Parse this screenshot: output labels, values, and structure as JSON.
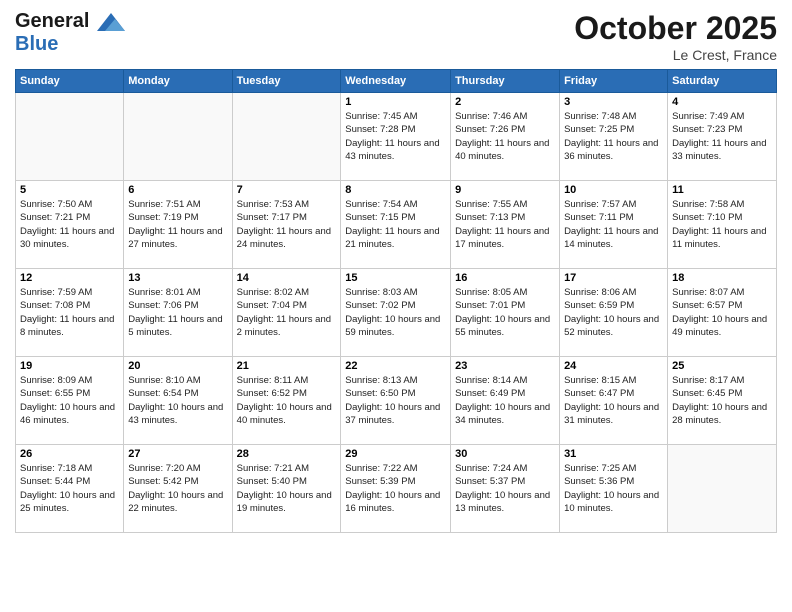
{
  "header": {
    "logo_line1": "General",
    "logo_line2": "Blue",
    "month": "October 2025",
    "location": "Le Crest, France"
  },
  "weekdays": [
    "Sunday",
    "Monday",
    "Tuesday",
    "Wednesday",
    "Thursday",
    "Friday",
    "Saturday"
  ],
  "weeks": [
    [
      {
        "day": "",
        "info": ""
      },
      {
        "day": "",
        "info": ""
      },
      {
        "day": "",
        "info": ""
      },
      {
        "day": "1",
        "info": "Sunrise: 7:45 AM\nSunset: 7:28 PM\nDaylight: 11 hours and 43 minutes."
      },
      {
        "day": "2",
        "info": "Sunrise: 7:46 AM\nSunset: 7:26 PM\nDaylight: 11 hours and 40 minutes."
      },
      {
        "day": "3",
        "info": "Sunrise: 7:48 AM\nSunset: 7:25 PM\nDaylight: 11 hours and 36 minutes."
      },
      {
        "day": "4",
        "info": "Sunrise: 7:49 AM\nSunset: 7:23 PM\nDaylight: 11 hours and 33 minutes."
      }
    ],
    [
      {
        "day": "5",
        "info": "Sunrise: 7:50 AM\nSunset: 7:21 PM\nDaylight: 11 hours and 30 minutes."
      },
      {
        "day": "6",
        "info": "Sunrise: 7:51 AM\nSunset: 7:19 PM\nDaylight: 11 hours and 27 minutes."
      },
      {
        "day": "7",
        "info": "Sunrise: 7:53 AM\nSunset: 7:17 PM\nDaylight: 11 hours and 24 minutes."
      },
      {
        "day": "8",
        "info": "Sunrise: 7:54 AM\nSunset: 7:15 PM\nDaylight: 11 hours and 21 minutes."
      },
      {
        "day": "9",
        "info": "Sunrise: 7:55 AM\nSunset: 7:13 PM\nDaylight: 11 hours and 17 minutes."
      },
      {
        "day": "10",
        "info": "Sunrise: 7:57 AM\nSunset: 7:11 PM\nDaylight: 11 hours and 14 minutes."
      },
      {
        "day": "11",
        "info": "Sunrise: 7:58 AM\nSunset: 7:10 PM\nDaylight: 11 hours and 11 minutes."
      }
    ],
    [
      {
        "day": "12",
        "info": "Sunrise: 7:59 AM\nSunset: 7:08 PM\nDaylight: 11 hours and 8 minutes."
      },
      {
        "day": "13",
        "info": "Sunrise: 8:01 AM\nSunset: 7:06 PM\nDaylight: 11 hours and 5 minutes."
      },
      {
        "day": "14",
        "info": "Sunrise: 8:02 AM\nSunset: 7:04 PM\nDaylight: 11 hours and 2 minutes."
      },
      {
        "day": "15",
        "info": "Sunrise: 8:03 AM\nSunset: 7:02 PM\nDaylight: 10 hours and 59 minutes."
      },
      {
        "day": "16",
        "info": "Sunrise: 8:05 AM\nSunset: 7:01 PM\nDaylight: 10 hours and 55 minutes."
      },
      {
        "day": "17",
        "info": "Sunrise: 8:06 AM\nSunset: 6:59 PM\nDaylight: 10 hours and 52 minutes."
      },
      {
        "day": "18",
        "info": "Sunrise: 8:07 AM\nSunset: 6:57 PM\nDaylight: 10 hours and 49 minutes."
      }
    ],
    [
      {
        "day": "19",
        "info": "Sunrise: 8:09 AM\nSunset: 6:55 PM\nDaylight: 10 hours and 46 minutes."
      },
      {
        "day": "20",
        "info": "Sunrise: 8:10 AM\nSunset: 6:54 PM\nDaylight: 10 hours and 43 minutes."
      },
      {
        "day": "21",
        "info": "Sunrise: 8:11 AM\nSunset: 6:52 PM\nDaylight: 10 hours and 40 minutes."
      },
      {
        "day": "22",
        "info": "Sunrise: 8:13 AM\nSunset: 6:50 PM\nDaylight: 10 hours and 37 minutes."
      },
      {
        "day": "23",
        "info": "Sunrise: 8:14 AM\nSunset: 6:49 PM\nDaylight: 10 hours and 34 minutes."
      },
      {
        "day": "24",
        "info": "Sunrise: 8:15 AM\nSunset: 6:47 PM\nDaylight: 10 hours and 31 minutes."
      },
      {
        "day": "25",
        "info": "Sunrise: 8:17 AM\nSunset: 6:45 PM\nDaylight: 10 hours and 28 minutes."
      }
    ],
    [
      {
        "day": "26",
        "info": "Sunrise: 7:18 AM\nSunset: 5:44 PM\nDaylight: 10 hours and 25 minutes."
      },
      {
        "day": "27",
        "info": "Sunrise: 7:20 AM\nSunset: 5:42 PM\nDaylight: 10 hours and 22 minutes."
      },
      {
        "day": "28",
        "info": "Sunrise: 7:21 AM\nSunset: 5:40 PM\nDaylight: 10 hours and 19 minutes."
      },
      {
        "day": "29",
        "info": "Sunrise: 7:22 AM\nSunset: 5:39 PM\nDaylight: 10 hours and 16 minutes."
      },
      {
        "day": "30",
        "info": "Sunrise: 7:24 AM\nSunset: 5:37 PM\nDaylight: 10 hours and 13 minutes."
      },
      {
        "day": "31",
        "info": "Sunrise: 7:25 AM\nSunset: 5:36 PM\nDaylight: 10 hours and 10 minutes."
      },
      {
        "day": "",
        "info": ""
      }
    ]
  ]
}
